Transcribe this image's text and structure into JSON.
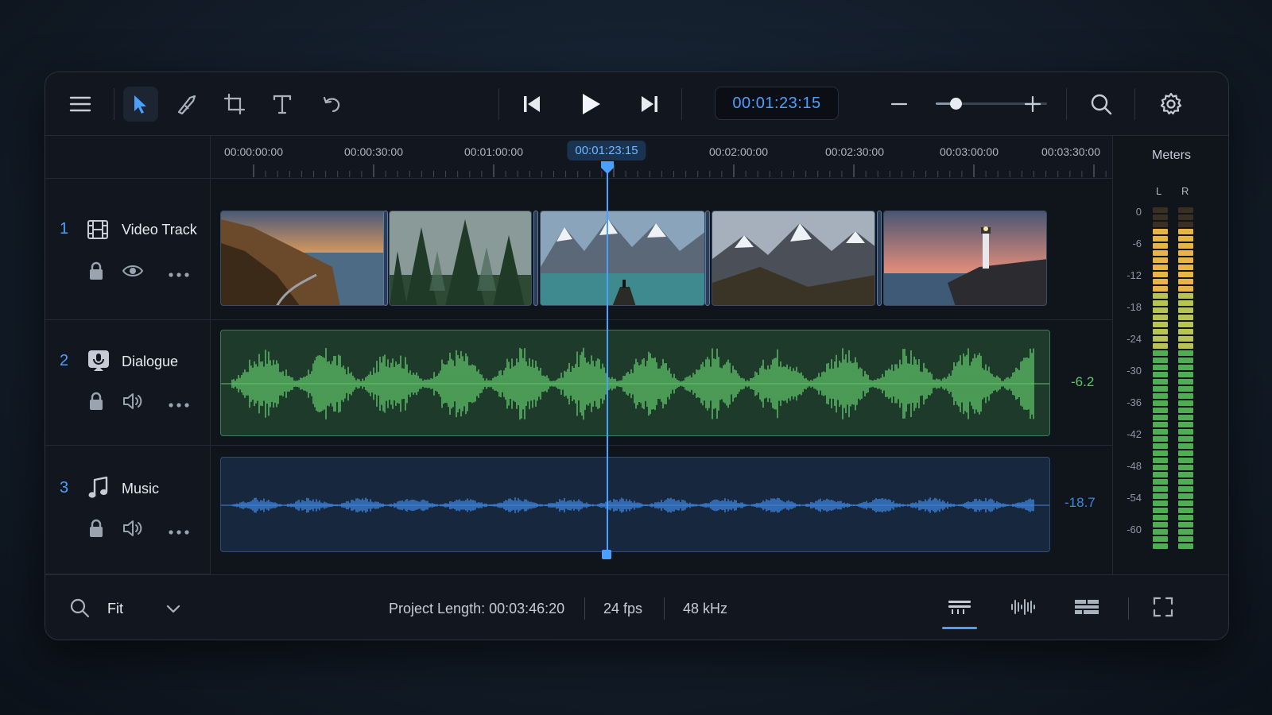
{
  "toolbar": {
    "timecode": "00:01:23:15",
    "zoom_level": 0.18,
    "tools": [
      "menu-icon",
      "select-icon",
      "razor-icon",
      "crop-icon",
      "text-icon",
      "undo-icon"
    ],
    "transport": [
      "skip-back-icon",
      "play-icon",
      "skip-forward-icon"
    ]
  },
  "ruler": {
    "ticks": [
      "00:00:00:00",
      "00:00:30:00",
      "00:01:00:00",
      "00:02:00:00",
      "00:02:30:00",
      "00:03:00:00",
      "00:03:30:00"
    ],
    "playhead_label": "00:01:23:15"
  },
  "tracks": [
    {
      "number": "1",
      "name": "Video Track",
      "type": "video"
    },
    {
      "number": "2",
      "name": "Dialogue",
      "type": "audio",
      "level": "-6.2",
      "color": "#5fc46a"
    },
    {
      "number": "3",
      "name": "Music",
      "type": "audio",
      "level": "-18.7",
      "color": "#3f86e0"
    }
  ],
  "video_clips": [
    "coastal-road",
    "misty-forest",
    "mountain-lake",
    "mountain-range",
    "lighthouse"
  ],
  "meters": {
    "title": "Meters",
    "left_label": "L",
    "right_label": "R",
    "scale": [
      "0",
      "-6",
      "-12",
      "-18",
      "-24",
      "-30",
      "-36",
      "-42",
      "-48",
      "-54",
      "-60"
    ]
  },
  "status": {
    "zoom_select": "Fit",
    "project_length": "Project Length: 00:03:46:20",
    "fps": "24 fps",
    "sample_rate": "48 kHz"
  },
  "colors": {
    "accent": "#4aa0ff",
    "dialogue": "#5fc46a",
    "music": "#3f86e0"
  }
}
